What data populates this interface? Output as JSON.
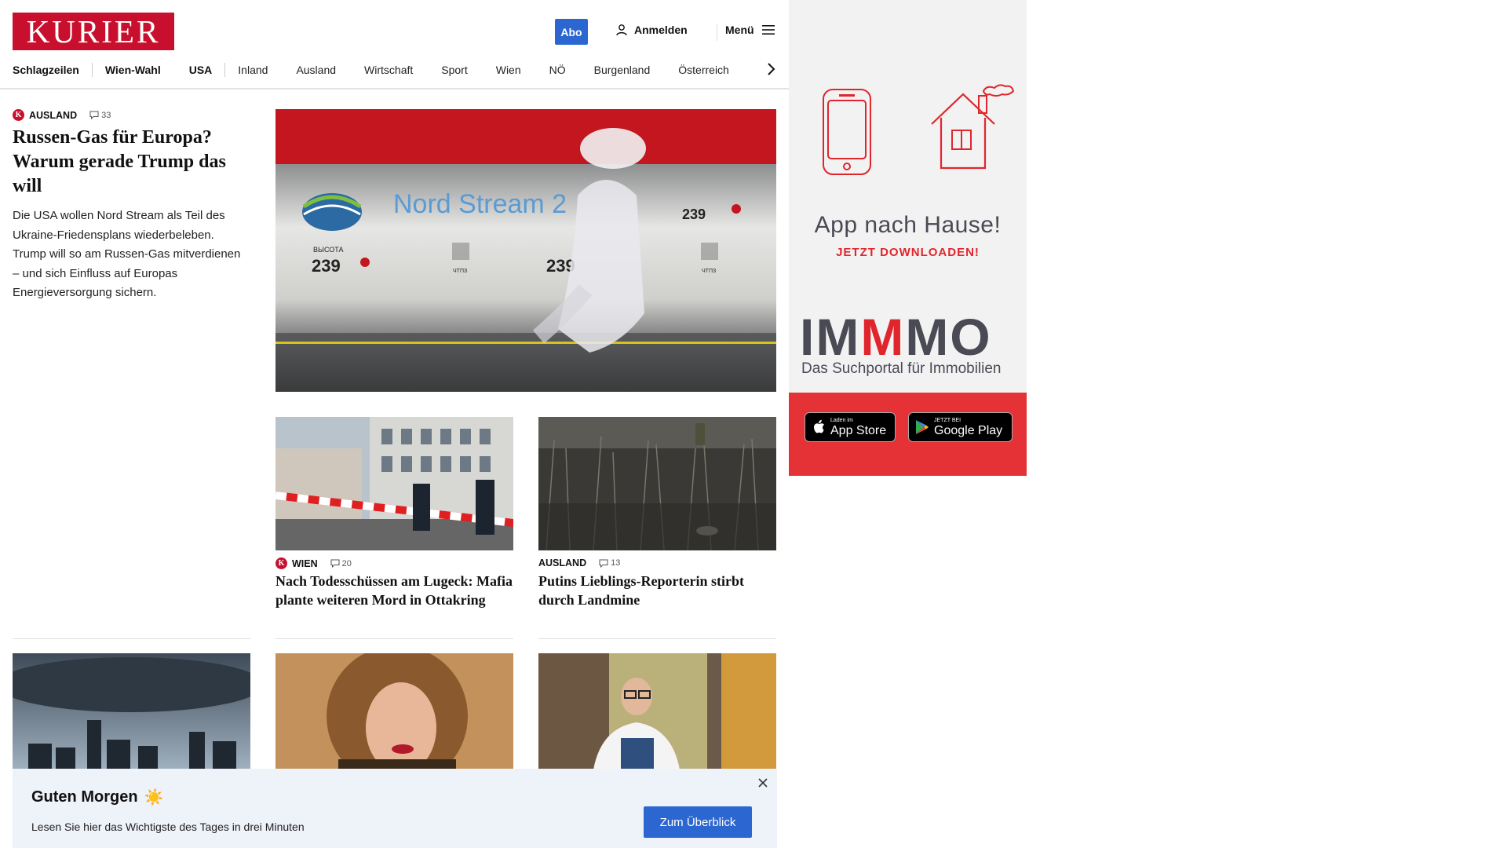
{
  "header": {
    "logo_text": "KURIER",
    "abo_label": "Abo",
    "login_label": "Anmelden",
    "menu_label": "Menü"
  },
  "nav": {
    "items": [
      "Schlagzeilen",
      "Wien-Wahl",
      "USA",
      "Inland",
      "Ausland",
      "Wirtschaft",
      "Sport",
      "Wien",
      "NÖ",
      "Burgenland",
      "Österreich"
    ]
  },
  "lead": {
    "category": "AUSLAND",
    "comments": "33",
    "title": "Russen-Gas für Europa? Warum gerade Trump das will",
    "teaser": "Die USA wollen Nord Stream als Teil des Ukraine-Friedensplans wiederbeleben. Trump will so am Russen-Gas mitverdienen – und sich Einfluss auf Europas Energieversorgung sichern.",
    "image": {
      "pipe_text": "Nord Stream 2",
      "marking": "239",
      "marking_label": "ВЫСОТА",
      "sublabel": "ЧТПЗ"
    }
  },
  "articles": [
    {
      "category": "WIEN",
      "premium": true,
      "comments": "20",
      "title": "Nach Todesschüssen am Lugeck: Mafia plante weiteren Mord in Ottakring"
    },
    {
      "category": "AUSLAND",
      "premium": false,
      "comments": "13",
      "title": "Putins Lieblings-Reporterin stirbt durch Landmine"
    }
  ],
  "premium_badge": "K",
  "ad": {
    "title": "App nach Hause!",
    "subtitle": "JETZT DOWNLOADEN!",
    "brand_a": "IM",
    "brand_b": "M",
    "brand_c": "MO",
    "brand_tagline": "Das Suchportal für Immobilien",
    "appstore_small": "Laden im",
    "appstore_big": "App Store",
    "googleplay_small": "JETZT BEI",
    "googleplay_big": "Google Play"
  },
  "banner": {
    "title": "Guten Morgen",
    "emoji": "☀️",
    "text": "Lesen Sie hier das Wichtigste des Tages in drei Minuten",
    "button": "Zum Überblick"
  },
  "colors": {
    "brand_red": "#c8102e",
    "button_blue": "#2c67d1",
    "ad_red": "#e53236"
  }
}
